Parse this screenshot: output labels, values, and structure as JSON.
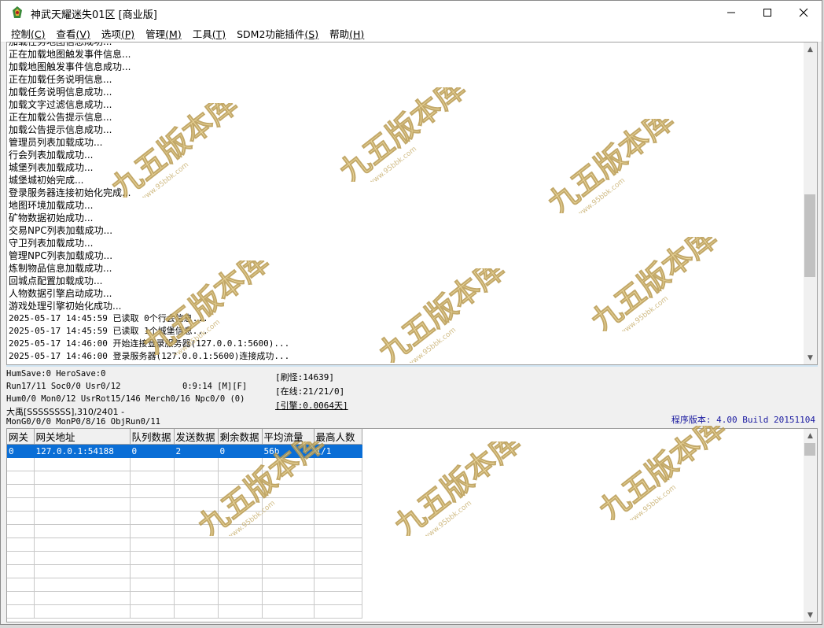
{
  "window": {
    "title": "神武天耀迷失01区 [商业版]",
    "controls": {
      "minimize": "—",
      "maximize": "☐",
      "close": "✕"
    }
  },
  "menu": [
    {
      "label": "控制",
      "acc": "(C)"
    },
    {
      "label": "查看",
      "acc": "(V)"
    },
    {
      "label": "选项",
      "acc": "(P)"
    },
    {
      "label": "管理",
      "acc": "(M)"
    },
    {
      "label": "工具",
      "acc": "(T)"
    },
    {
      "label": "SDM2功能插件",
      "acc": "(S)"
    },
    {
      "label": "帮助",
      "acc": "(H)"
    }
  ],
  "log": [
    "加载任务地图信息成功...",
    "正在加载地图触发事件信息...",
    "加载地图触发事件信息成功...",
    "正在加载任务说明信息...",
    "加载任务说明信息成功...",
    "加载文字过滤信息成功...",
    "正在加载公告提示信息...",
    "加载公告提示信息成功...",
    "管理员列表加载成功...",
    "行会列表加载成功...",
    "城堡列表加载成功...",
    "城堡城初始完成...",
    "登录服务器连接初始化完成...",
    "地图环境加载成功...",
    "矿物数据初始成功...",
    "交易NPC列表加载成功...",
    "守卫列表加载成功...",
    "管理NPC列表加载成功...",
    "炼制物品信息加载成功...",
    "回城点配置加载成功...",
    "人物数据引擎启动成功...",
    "游戏处理引擎初始化成功...",
    "2025-05-17 14:45:59 已读取 0个行会信息...",
    "2025-05-17 14:45:59 已读取 1个城堡信息...",
    "2025-05-17 14:46:00 开始连接登录服务器(127.0.0.1:5600)...",
    "2025-05-17 14:46:00 登录服务器(127.0.0.1:5600)连接成功..."
  ],
  "status": {
    "line1": "HumSave:0 HeroSave:0",
    "line2a": "Run17/11 Soc0/0 Usr0/12",
    "line2b": "0:9:14 [M][F]",
    "line3": "Hum0/0 Mon0/12 UsrRot15/146 Merch0/16 Npc0/0 (0)",
    "line4": "大禹[SSSSSSSS],310/2401 -",
    "line5": "MonG0/0/0 MonP0/8/16 ObjRun0/11",
    "refresh": "[刷怪:14639]",
    "online": "[在线:21/21/0]",
    "engine": "[引擎:0.0064天]",
    "version": "程序版本: 4.00 Build 20151104"
  },
  "grid": {
    "columns": [
      "网关",
      "网关地址",
      "队列数据",
      "发送数据",
      "剩余数据",
      "平均流量",
      "最高人数"
    ],
    "rows": [
      [
        "0",
        "127.0.0.1:54188",
        "0",
        "2",
        "0",
        "56b",
        "1/1"
      ]
    ],
    "empty_rows": 12
  },
  "watermark": {
    "text": "九五版本库",
    "url": "www.95bbk.com",
    "color": "#e8d08a"
  }
}
